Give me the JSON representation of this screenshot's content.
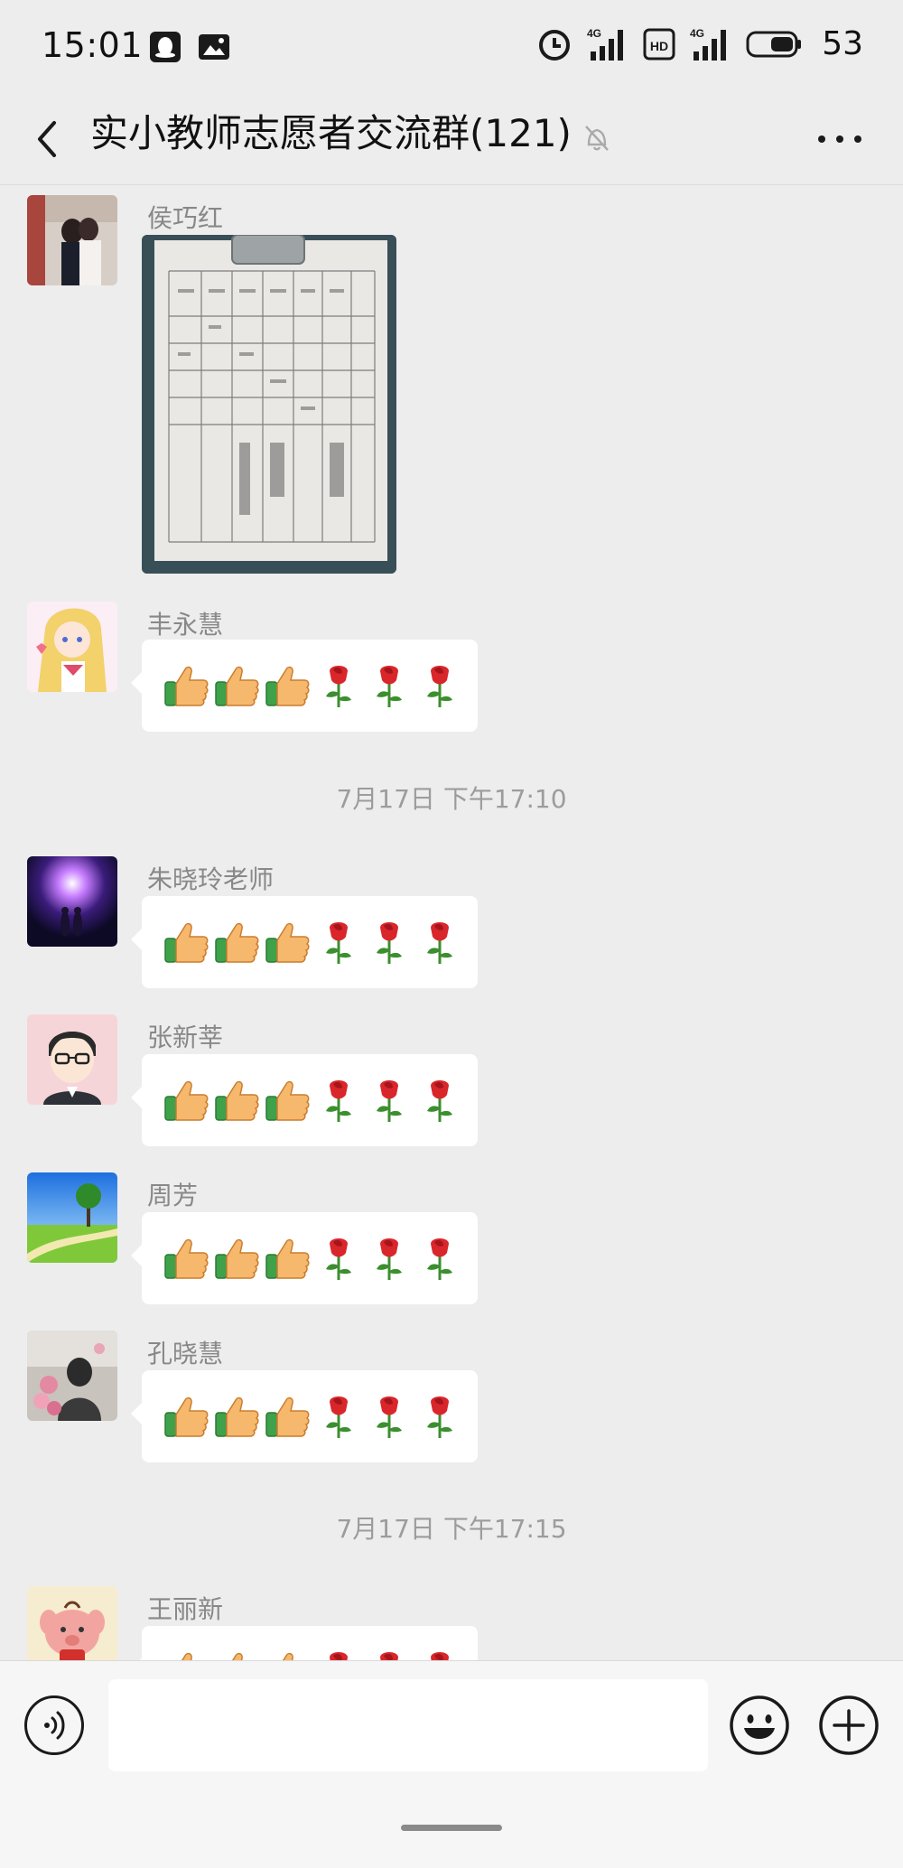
{
  "status_bar": {
    "time": "15:01",
    "battery_level": "53",
    "network_1": "4G",
    "network_2": "4G",
    "hd_label": "HD"
  },
  "header": {
    "title": "实小教师志愿者交流群(121)",
    "muted": true
  },
  "messages": [
    {
      "sender": "侯巧红",
      "type": "image"
    },
    {
      "sender": "丰永慧",
      "type": "emoji",
      "emojis": [
        "thumbs-up",
        "thumbs-up",
        "thumbs-up",
        "rose",
        "rose",
        "rose"
      ]
    },
    {
      "type": "timestamp",
      "text": "7月17日 下午17:10"
    },
    {
      "sender": "朱晓玲老师",
      "type": "emoji",
      "emojis": [
        "thumbs-up",
        "thumbs-up",
        "thumbs-up",
        "rose",
        "rose",
        "rose"
      ]
    },
    {
      "sender": "张新莘",
      "type": "emoji",
      "emojis": [
        "thumbs-up",
        "thumbs-up",
        "thumbs-up",
        "rose",
        "rose",
        "rose"
      ]
    },
    {
      "sender": "周芳",
      "type": "emoji",
      "emojis": [
        "thumbs-up",
        "thumbs-up",
        "thumbs-up",
        "rose",
        "rose",
        "rose"
      ]
    },
    {
      "sender": "孔晓慧",
      "type": "emoji",
      "emojis": [
        "thumbs-up",
        "thumbs-up",
        "thumbs-up",
        "rose",
        "rose",
        "rose"
      ]
    },
    {
      "type": "timestamp",
      "text": "7月17日 下午17:15"
    },
    {
      "sender": "王丽新",
      "type": "emoji",
      "emojis": [
        "thumbs-up",
        "thumbs-up",
        "thumbs-up",
        "rose",
        "rose",
        "rose"
      ]
    }
  ],
  "input_bar": {
    "placeholder": ""
  },
  "icons": {
    "back": "chevron-left-icon",
    "mute": "bell-muted-icon",
    "more": "more-dots-icon",
    "voice": "voice-icon",
    "emoji": "smiley-icon",
    "plus": "plus-icon"
  }
}
